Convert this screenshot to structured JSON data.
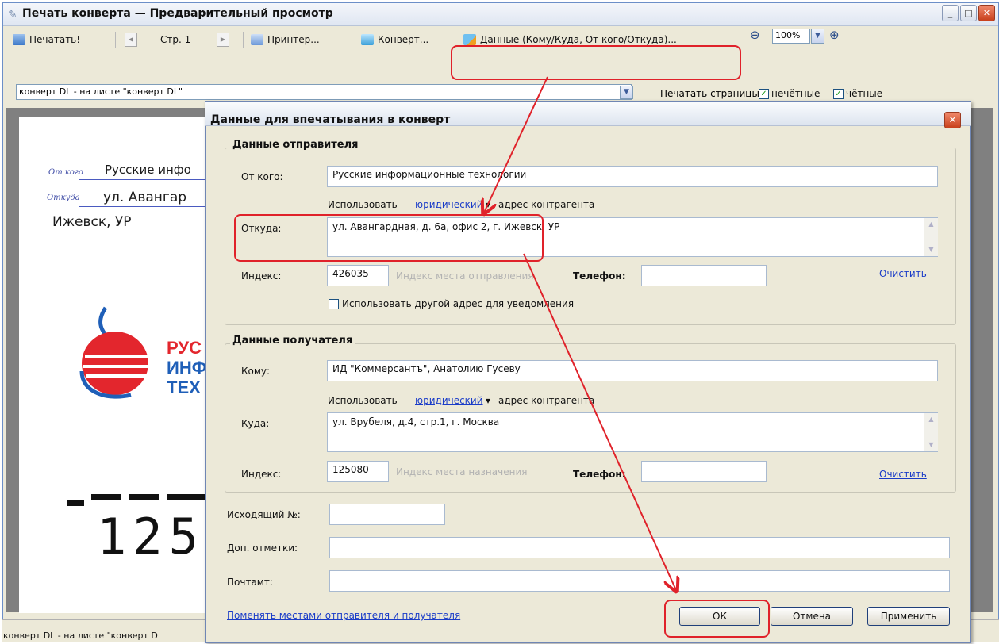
{
  "window": {
    "title": "Печать конверта — Предварительный просмотр"
  },
  "toolbar": {
    "print_label": "Печатать!",
    "page_label": "Стр. 1",
    "printer_label": "Принтер...",
    "envelope_label": "Конверт...",
    "data_label": "Данные (Кому/Куда, От кого/Откуда)...",
    "zoom_value": "100%"
  },
  "envelope_select": {
    "value": "конверт DL - на листе \"конверт DL\""
  },
  "pages": {
    "label": "Печатать страницы:",
    "odd_label": "нечётные",
    "even_label": "чётные",
    "odd_checked": true,
    "even_checked": true
  },
  "preview": {
    "from_label": "От кого",
    "from_value": "Русские инфо",
    "where_label": "Откуда",
    "where_value": "ул. Авангар",
    "city_value": "Ижевск, УР",
    "logo_lines": [
      "РУС",
      "ИНФ",
      "ТЕХ"
    ],
    "zip_digits": "125"
  },
  "status": {
    "text": "конверт DL - на листе \"конверт D"
  },
  "dialog": {
    "title": "Данные для впечатывания в конверт",
    "sender": {
      "group_title": "Данные отправителя",
      "from_label": "От кого:",
      "from_value": "Русские информационные технологии",
      "use_prefix": "Использовать",
      "use_link": "юридический",
      "use_suffix": "адрес контрагента",
      "where_label": "Откуда:",
      "where_value": "ул. Авангардная, д. 6а, офис 2, г. Ижевск, УР",
      "index_label": "Индекс:",
      "index_value": "426035",
      "index_placeholder": "Индекс места отправления",
      "phone_label": "Телефон:",
      "phone_value": "",
      "clear_link": "Очистить",
      "other_address_label": "Использовать другой адрес для уведомления",
      "other_address_checked": false
    },
    "recipient": {
      "group_title": "Данные получателя",
      "to_label": "Кому:",
      "to_value": "ИД \"Коммерсантъ\", Анатолию Гусеву",
      "use_prefix": "Использовать",
      "use_link": "юридический",
      "use_suffix": "адрес контрагента",
      "where_label": "Куда:",
      "where_value": "ул. Врубеля, д.4, стр.1, г. Москва",
      "index_label": "Индекс:",
      "index_value": "125080",
      "index_placeholder": "Индекс места назначения",
      "phone_label": "Телефон:",
      "phone_value": "",
      "clear_link": "Очистить"
    },
    "outgoing_label": "Исходящий №:",
    "outgoing_value": "",
    "marks_label": "Доп. отметки:",
    "marks_value": "",
    "post_office_label": "Почтамт:",
    "post_office_value": "",
    "swap_link": "Поменять местами отправителя и получателя",
    "ok_label": "ОК",
    "cancel_label": "Отмена",
    "apply_label": "Применить"
  },
  "colors": {
    "annotation_red": "#e0222a",
    "link_blue": "#1a3cc8",
    "logo_red": "#e3262d",
    "logo_blue": "#1f5fb8",
    "dialog_bg": "#ece9d8"
  },
  "icons": [
    "app-icon",
    "print-icon",
    "prev-page-icon",
    "next-page-icon",
    "printer-icon",
    "envelope-icon",
    "data-edit-icon",
    "zoom-out-icon",
    "zoom-in-icon",
    "dropdown-icon",
    "close-icon",
    "minimize-icon",
    "maximize-icon",
    "scroll-up-icon",
    "scroll-down-icon"
  ]
}
